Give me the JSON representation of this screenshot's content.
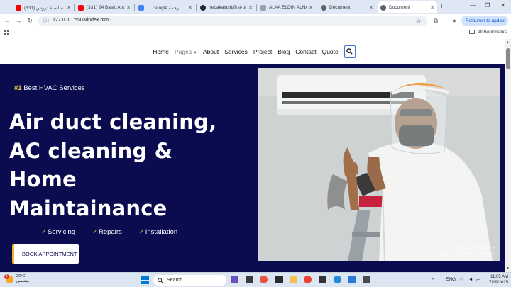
{
  "browser": {
    "tabs": [
      {
        "label": "(331) سلسلة دروس ..."
      },
      {
        "label": "(331) 24 Basic Array"
      },
      {
        "label": "Google ترجمة"
      },
      {
        "label": "hebakalash/first-pro"
      },
      {
        "label": "ALAA ELDIN ALHAL"
      },
      {
        "label": "Document"
      },
      {
        "label": "Document"
      }
    ],
    "url": "127.0.0.1:5503/index.html",
    "relaunch_label": "Relaunch to update",
    "all_bookmarks_label": "All Bookmarks"
  },
  "site": {
    "nav": [
      "Home",
      "Pages",
      "About",
      "Services",
      "Project",
      "Blog",
      "Contact",
      "Quote"
    ],
    "hero": {
      "badge_number": "#1",
      "badge_text": "Best HVAC Services",
      "heading_lines": [
        "Air duct cleaning,",
        "AC cleaning &",
        "Home",
        "Maintainance"
      ],
      "services": [
        "Servicing",
        "Repairs",
        "Installation"
      ],
      "check_glyph": "✓",
      "cta_label": "BOOK APPOINTMENT",
      "watermark_line1": "Activate Windows",
      "watermark_line2": "Go to Settings to activate Windows."
    }
  },
  "taskbar": {
    "weather_temp": "29°C",
    "weather_desc": "مشمس",
    "weather_badge": "1",
    "search_placeholder": "Search",
    "language": "ENG",
    "time": "11:05 AM",
    "date": "7/19/2025"
  },
  "colors": {
    "hero_background": "#0b0b4f",
    "accent_yellow": "#f2c94c",
    "tab_strip": "#dfe7f5",
    "taskbar": "#dce6f2"
  }
}
